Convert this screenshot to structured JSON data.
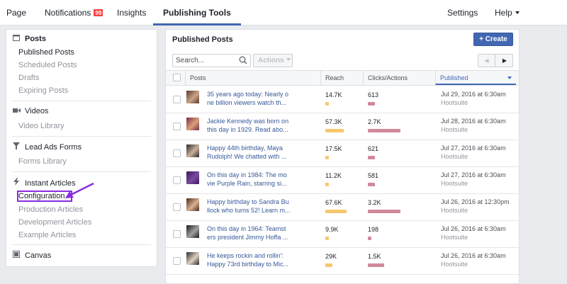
{
  "topnav": {
    "page": "Page",
    "notifications": "Notifications",
    "notifications_badge": "99",
    "insights": "Insights",
    "publishing_tools": "Publishing Tools",
    "settings": "Settings",
    "help": "Help"
  },
  "sidebar": {
    "posts": {
      "title": "Posts",
      "items": [
        "Published Posts",
        "Scheduled Posts",
        "Drafts",
        "Expiring Posts"
      ]
    },
    "videos": {
      "title": "Videos",
      "items": [
        "Video Library"
      ]
    },
    "lead_ads": {
      "title": "Lead Ads Forms",
      "items": [
        "Forms Library"
      ]
    },
    "instant_articles": {
      "title": "Instant Articles",
      "items": [
        "Configuration",
        "Production Articles",
        "Development Articles",
        "Example Articles"
      ]
    },
    "canvas": {
      "title": "Canvas"
    }
  },
  "main": {
    "title": "Published Posts",
    "create_label": "+ Create",
    "search_placeholder": "Search...",
    "actions_label": "Actions",
    "columns": {
      "posts": "Posts",
      "reach": "Reach",
      "clicks": "Clicks/Actions",
      "published": "Published"
    },
    "rows": [
      {
        "text": "35 years ago today: Nearly o ne billion viewers watch th...",
        "reach": "14.7K",
        "clicks": "613",
        "reach_fraction": 0.11,
        "clicks_fraction": 0.22,
        "date": "Jul 29, 2016 at 6:30am",
        "source": "Hootsuite"
      },
      {
        "text": "Jackie Kennedy was born on this day in 1929. Read abo...",
        "reach": "57.3K",
        "clicks": "2.7K",
        "reach_fraction": 0.85,
        "clicks_fraction": 1.0,
        "date": "Jul 28, 2016 at 6:30am",
        "source": "Hootsuite"
      },
      {
        "text": "Happy 44th birthday, Maya Rudolph! We chatted with ...",
        "reach": "17.5K",
        "clicks": "621",
        "reach_fraction": 0.11,
        "clicks_fraction": 0.22,
        "date": "Jul 27, 2016 at 6:30am",
        "source": "Hootsuite"
      },
      {
        "text": "On this day in 1984: The mo vie Purple Rain, starring si...",
        "reach": "11.2K",
        "clicks": "581",
        "reach_fraction": 0.11,
        "clicks_fraction": 0.22,
        "date": "Jul 27, 2016 at 6:30am",
        "source": "Hootsuite"
      },
      {
        "text": "Happy birthday to Sandra Bu llock who turns 52! Learn m...",
        "reach": "67.6K",
        "clicks": "3.2K",
        "reach_fraction": 1.0,
        "clicks_fraction": 1.0,
        "date": "Jul 26, 2016 at 12:30pm",
        "source": "Hootsuite"
      },
      {
        "text": "On this day in 1964: Teamst ers president Jimmy Hoffa ...",
        "reach": "9.9K",
        "clicks": "198",
        "reach_fraction": 0.11,
        "clicks_fraction": 0.11,
        "date": "Jul 26, 2016 at 6:30am",
        "source": "Hootsuite"
      },
      {
        "text": "He keeps rockin and rollin': Happy 73rd birthday to Mic...",
        "reach": "29K",
        "clicks": "1.5K",
        "reach_fraction": 0.33,
        "clicks_fraction": 0.5,
        "date": "Jul 26, 2016 at 6:30am",
        "source": "Hootsuite"
      }
    ]
  },
  "colors": {
    "accent": "#4267b2",
    "link": "#365899",
    "badge": "#fa3e3e",
    "reach_bar": "#f7c770",
    "clicks_bar": "#d08a9b",
    "highlight": "#8a2be2"
  },
  "icons": {
    "posts": "calendar-icon",
    "videos": "video-camera-icon",
    "lead_ads": "funnel-icon",
    "instant_articles": "lightning-icon",
    "canvas": "canvas-icon",
    "search": "search-icon"
  }
}
